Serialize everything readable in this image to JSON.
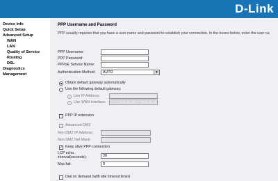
{
  "brand": {
    "logo_text": "D-Link"
  },
  "nav": {
    "device_info": "Device Info",
    "quick_setup": "Quick Setup",
    "advanced_setup": "Advanced Setup",
    "wan": "WAN",
    "lan": "LAN",
    "qos": "Quality of Service",
    "routing": "Routing",
    "dsl": "DSL",
    "diagnostics": "Diagnostics",
    "management": "Management"
  },
  "page": {
    "title": "PPP Username and Password",
    "description": "PPP usually requires that you have a user name and password to establish your connection. In the boxes below, enter the user na"
  },
  "form": {
    "username_label": "PPP Username:",
    "password_label": "PPP Password:",
    "service_name_label": "PPPoE Service Name:",
    "auth_label": "Authentication Method:",
    "auth_value": "AUTO",
    "gw_auto_label": "Obtain default gateway automatically",
    "gw_manual_label": "Use the following default gateway:",
    "gw_ip_label": "Use IP Address:",
    "gw_wan_label": "Use WAN Interface:",
    "gw_wan_value": "pppoe_0_0_35_1/ppp_0_0_35_1",
    "ppp_ip_ext_label": "PPP IP extension",
    "adv_dmz_label": "Advanced DMZ",
    "non_dmz_ip_label": "Non DMZ IP Address:",
    "non_dmz_mask_label": "Non DMZ Net Mask:",
    "keepalive_label": "Keep alive PPP connection",
    "lcp_label_1": "LCP echo",
    "lcp_label_2": "interval(seconds):",
    "lcp_value": "30",
    "max_fail_label": "Max fail:",
    "max_fail_value": "0",
    "dial_on_demand_label": "Dial on demand (with idle timeout timer)"
  }
}
